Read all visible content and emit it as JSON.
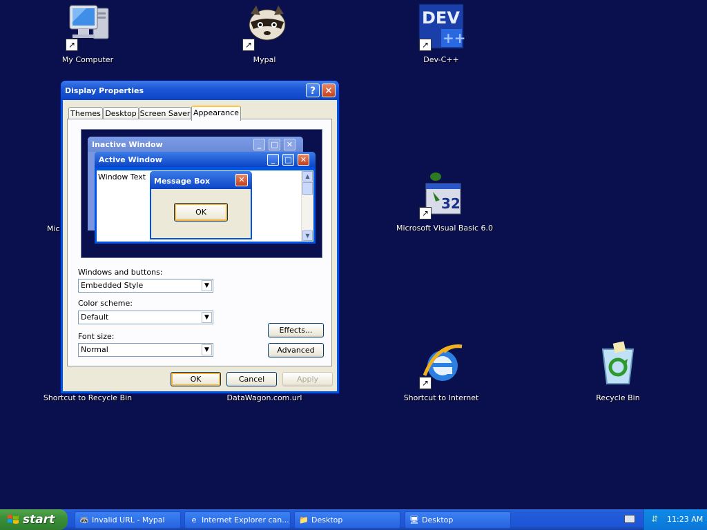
{
  "desktop": {
    "icons": [
      {
        "label": "My Computer"
      },
      {
        "label": "Mypal"
      },
      {
        "label": "Dev-C++"
      },
      {
        "label": "Microsoft Visual Basic 6.0"
      },
      {
        "label": "Shortcut to Recycle Bin"
      },
      {
        "label": "DataWagon.com.url"
      },
      {
        "label": "Shortcut to Internet"
      },
      {
        "label": "Recycle Bin"
      }
    ],
    "partial_label": "Micr"
  },
  "dialog": {
    "title": "Display Properties",
    "help_glyph": "?",
    "close_glyph": "✕",
    "tabs": [
      "Themes",
      "Desktop",
      "Screen Saver",
      "Appearance"
    ],
    "active_tab": "Appearance",
    "preview": {
      "inactive_title": "Inactive Window",
      "active_title": "Active Window",
      "window_text": "Window Text",
      "message_box_title": "Message Box",
      "ok_label": "OK"
    },
    "windows_buttons_label": "Windows and buttons:",
    "windows_buttons_value": "Embedded Style",
    "color_scheme_label": "Color scheme:",
    "color_scheme_value": "Default",
    "font_size_label": "Font size:",
    "font_size_value": "Normal",
    "effects_label": "Effects...",
    "advanced_label": "Advanced",
    "ok_label": "OK",
    "cancel_label": "Cancel",
    "apply_label": "Apply"
  },
  "taskbar": {
    "start_label": "start",
    "tasks": [
      {
        "label": "Invalid URL - Mypal"
      },
      {
        "label": "Internet Explorer can..."
      },
      {
        "label": "Desktop"
      },
      {
        "label": "Desktop"
      }
    ],
    "clock": "11:23 AM"
  },
  "colors": {
    "desktop_background": "#0a0f4e",
    "title_bar": "#0054e3",
    "taskbar": "#245edb",
    "start_button": "#3c8f3a"
  }
}
